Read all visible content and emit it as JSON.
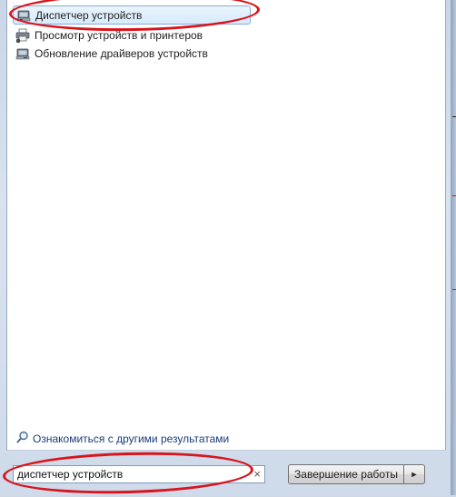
{
  "results": {
    "items": [
      {
        "label": "Диспетчер устройств",
        "icon": "device-manager-icon",
        "selected": true
      },
      {
        "label": "Просмотр устройств и принтеров",
        "icon": "devices-printers-icon",
        "selected": false
      },
      {
        "label": "Обновление драйверов устройств",
        "icon": "update-drivers-icon",
        "selected": false
      }
    ],
    "more_results_label": "Ознакомиться с другими результатами"
  },
  "search": {
    "value": "диспетчер устройств",
    "clear_glyph": "×"
  },
  "power": {
    "shutdown_label": "Завершение работы",
    "arrow_glyph": "►"
  },
  "colors": {
    "annotation": "#d8141c",
    "selection_border": "#84acdd",
    "link": "#1a3e7a"
  }
}
